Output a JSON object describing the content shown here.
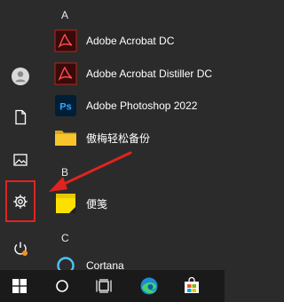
{
  "start_menu": {
    "sections": [
      {
        "letter": "A",
        "apps": [
          {
            "label": "Adobe Acrobat DC",
            "icon": "adobe-acrobat-icon"
          },
          {
            "label": "Adobe Acrobat Distiller DC",
            "icon": "adobe-distiller-icon"
          },
          {
            "label": "Adobe Photoshop 2022",
            "icon": "photoshop-icon",
            "icon_text": "Ps"
          },
          {
            "label": "傲梅轻松备份",
            "icon": "folder-icon"
          }
        ]
      },
      {
        "letter": "B",
        "apps": [
          {
            "label": "便笺",
            "icon": "sticky-notes-icon"
          }
        ]
      },
      {
        "letter": "C",
        "apps": [
          {
            "label": "Cortana",
            "icon": "cortana-icon"
          }
        ]
      }
    ],
    "rail": [
      "user-icon",
      "documents-icon",
      "pictures-icon",
      "settings-icon",
      "power-icon"
    ]
  },
  "annotation": {
    "highlight_color": "#e0231f",
    "target": "settings-icon"
  },
  "taskbar": {
    "items": [
      "windows-start-icon",
      "search-icon",
      "task-view-icon",
      "edge-icon",
      "store-icon"
    ]
  },
  "colors": {
    "menu_bg": "#2b2b2b",
    "taskbar_bg": "#1a1a1a",
    "accent_red": "#e0231f",
    "photoshop_blue": "#31a8ff",
    "folder_yellow": "#f7c52b"
  }
}
